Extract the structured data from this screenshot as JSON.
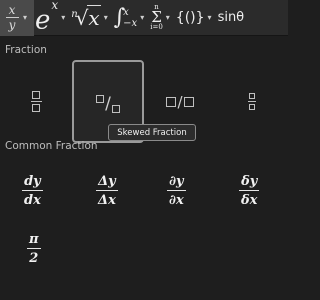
{
  "toolbar": {
    "items": [
      {
        "icon": "fraction-icon",
        "num": "x",
        "den": "y"
      },
      {
        "icon": "exponent-icon",
        "base": "e",
        "sup": "x"
      },
      {
        "icon": "radical-icon",
        "index": "n",
        "radicand": "x"
      },
      {
        "icon": "integral-icon",
        "upper": "x",
        "lower": "−x"
      },
      {
        "icon": "large-operator-icon",
        "upper": "n",
        "lower": "i=0"
      },
      {
        "icon": "bracket-icon",
        "text": "{()}"
      },
      {
        "icon": "function-icon",
        "text": "sinθ"
      }
    ],
    "caret": "▾"
  },
  "fraction_section": {
    "label": "Fraction",
    "tooltip": "Skewed Fraction",
    "items": [
      "stacked-fraction",
      "skewed-fraction",
      "linear-fraction",
      "small-fraction"
    ],
    "slash": "/"
  },
  "common_section": {
    "label": "Common Fraction",
    "items": [
      {
        "num": "dy",
        "den": "dx"
      },
      {
        "num": "Δy",
        "den": "Δx"
      },
      {
        "num": "∂y",
        "den": "∂x"
      },
      {
        "num": "δy",
        "den": "δx"
      },
      {
        "num": "π",
        "den": "2"
      }
    ]
  }
}
